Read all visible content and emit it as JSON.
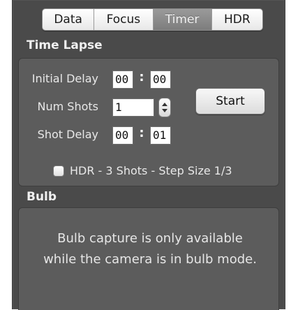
{
  "tabs": [
    {
      "label": "Data",
      "active": false
    },
    {
      "label": "Focus",
      "active": false
    },
    {
      "label": "Timer",
      "active": true
    },
    {
      "label": "HDR",
      "active": false
    }
  ],
  "time_lapse": {
    "title": "Time Lapse",
    "initial_delay": {
      "label": "Initial Delay",
      "minutes": "00",
      "seconds": "00"
    },
    "num_shots": {
      "label": "Num Shots",
      "value": "1"
    },
    "shot_delay": {
      "label": "Shot Delay",
      "minutes": "00",
      "seconds": "01"
    },
    "separator": ":",
    "start_label": "Start",
    "hdr_checkbox": {
      "label": "HDR - 3 Shots - Step Size 1/3",
      "checked": false
    }
  },
  "bulb": {
    "title": "Bulb",
    "message_line1": "Bulb capture is only available",
    "message_line2": "while the camera is in bulb mode."
  },
  "colors": {
    "panel_bg": "#4a4a4a",
    "box_bg": "#5c5c5c",
    "active_tab": "#8a8a8a"
  }
}
